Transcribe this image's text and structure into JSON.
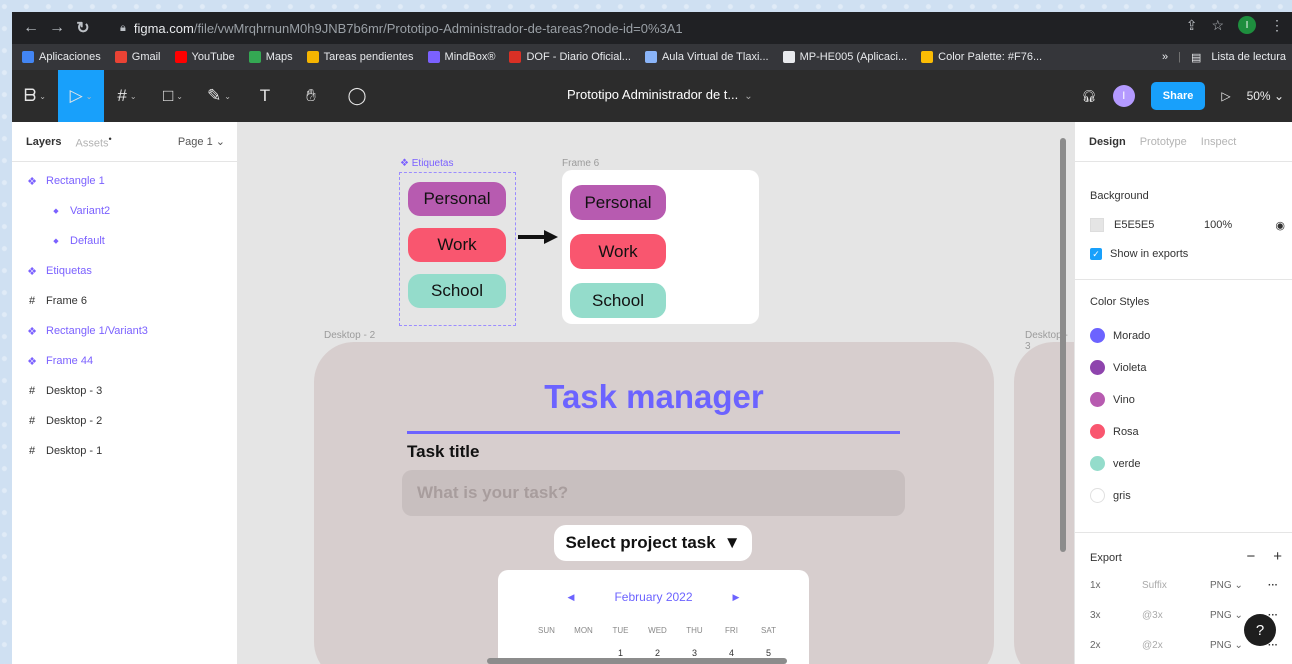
{
  "browser": {
    "url_domain": "figma.com",
    "url_path": "/file/vwMrqhrnunM0h9JNB7b6mr/Prototipo-Administrador-de-tareas?node-id=0%3A1",
    "profile_initial": "I",
    "bookmarks": [
      {
        "label": "Aplicaciones",
        "color": "#4285f4"
      },
      {
        "label": "Gmail",
        "color": "#ea4335"
      },
      {
        "label": "YouTube",
        "color": "#ff0000"
      },
      {
        "label": "Maps",
        "color": "#34a853"
      },
      {
        "label": "Tareas pendientes",
        "color": "#f4b400"
      },
      {
        "label": "MindBox®",
        "color": "#7b61ff"
      },
      {
        "label": "DOF - Diario Oficial...",
        "color": "#d93025"
      },
      {
        "label": "Aula Virtual de Tlaxi...",
        "color": "#8ab4f8"
      },
      {
        "label": "MP-HE005 (Aplicaci...",
        "color": "#e8eaed"
      },
      {
        "label": "Color Palette: #F76...",
        "color": "#fbbc04"
      }
    ],
    "more_label": "»",
    "reading_list": "Lista de lectura"
  },
  "figma": {
    "file_title": "Prototipo Administrador de t...",
    "share_label": "Share",
    "zoom": "50%",
    "avatar_initial": "I"
  },
  "layers_panel": {
    "tab_layers": "Layers",
    "tab_assets": "Assets",
    "page": "Page 1",
    "items": [
      {
        "label": "Rectangle 1",
        "type": "component"
      },
      {
        "label": "Variant2",
        "type": "variant"
      },
      {
        "label": "Default",
        "type": "variant"
      },
      {
        "label": "Etiquetas",
        "type": "component"
      },
      {
        "label": "Frame 6",
        "type": "frame"
      },
      {
        "label": "Rectangle 1/Variant3",
        "type": "component"
      },
      {
        "label": "Frame 44",
        "type": "component"
      },
      {
        "label": "Desktop - 3",
        "type": "frame"
      },
      {
        "label": "Desktop - 2",
        "type": "frame"
      },
      {
        "label": "Desktop - 1",
        "type": "frame"
      }
    ]
  },
  "canvas": {
    "etiquetas_label": "Etiquetas",
    "frame6_label": "Frame 6",
    "desktop2_label": "Desktop - 2",
    "desktop3_label": "Desktop - 3",
    "tags": [
      {
        "label": "Personal",
        "color": "#b75bb0"
      },
      {
        "label": "Work",
        "color": "#f9566f"
      },
      {
        "label": "School",
        "color": "#94dccb"
      }
    ],
    "app": {
      "title": "Task manager",
      "task_title_label": "Task title",
      "task_placeholder": "What is your task?",
      "select_project": "Select project task",
      "calendar_month": "February 2022",
      "weekdays": [
        "SUN",
        "MON",
        "TUE",
        "WED",
        "THU",
        "FRI",
        "SAT"
      ],
      "first_week": [
        "",
        "",
        "1",
        "2",
        "3",
        "4",
        "5"
      ]
    }
  },
  "design_panel": {
    "tab_design": "Design",
    "tab_prototype": "Prototype",
    "tab_inspect": "Inspect",
    "background_title": "Background",
    "background_hex": "E5E5E5",
    "background_opacity": "100%",
    "show_in_exports": "Show in exports",
    "color_styles_title": "Color Styles",
    "color_styles": [
      {
        "name": "Morado",
        "color": "#6c63ff"
      },
      {
        "name": "Violeta",
        "color": "#8e44ad"
      },
      {
        "name": "Vino",
        "color": "#b75bb0"
      },
      {
        "name": "Rosa",
        "color": "#f9566f"
      },
      {
        "name": "verde",
        "color": "#94dccb"
      },
      {
        "name": "gris",
        "color": "#ffffff"
      }
    ],
    "export_title": "Export",
    "export_rows": [
      {
        "scale": "1x",
        "suffix": "Suffix",
        "format": "PNG"
      },
      {
        "scale": "3x",
        "suffix": "@3x",
        "format": "PNG"
      },
      {
        "scale": "2x",
        "suffix": "@2x",
        "format": "PNG"
      }
    ]
  }
}
